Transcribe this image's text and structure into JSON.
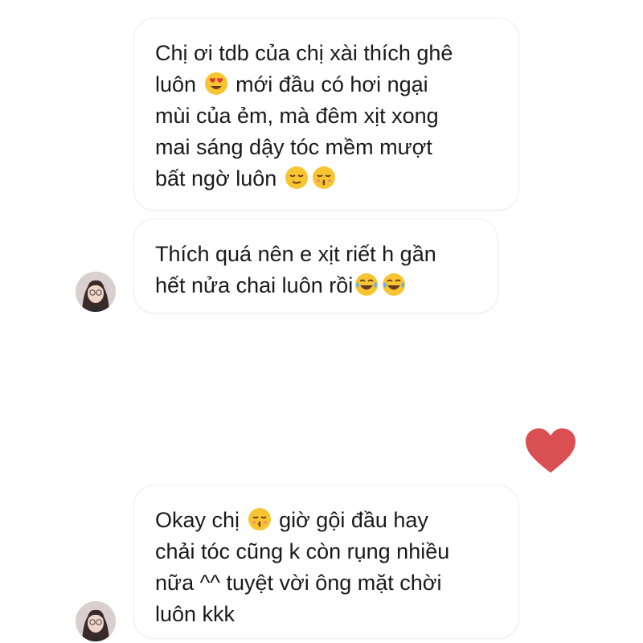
{
  "messages": [
    {
      "sender": "contact",
      "lines": [
        {
          "text": "Chị ơi tdb của chị xài thích ghê"
        },
        {
          "before": "luôn",
          "emoji": "heart-eyes-emoji",
          "after": "mới đầu có hơi ngại"
        },
        {
          "text": "mùi của ẻm, mà đêm xịt xong"
        },
        {
          "text": "mai sáng dậy tóc mềm mượt"
        },
        {
          "before": "bất ngờ luôn",
          "emojis": [
            "relieved-emoji",
            "kissing-emoji"
          ]
        }
      ]
    },
    {
      "sender": "contact",
      "lines": [
        {
          "text": "Thích quá nên e xịt riết h gần"
        },
        {
          "before": "hết nửa chai luôn rồi",
          "emojis": [
            "tears-of-joy-emoji",
            "tears-of-joy-emoji"
          ]
        }
      ]
    },
    {
      "sender": "contact",
      "lines": [
        {
          "before": "Okay chị",
          "emoji": "kissing-emoji",
          "after": "giờ gội đầu hay"
        },
        {
          "text": "chải tóc cũng k còn rụng nhiều"
        },
        {
          "text": "nữa ^^ tuyệt vời ông mặt chời"
        },
        {
          "text": "luôn kkk"
        }
      ]
    }
  ],
  "reaction": {
    "icon": "heart-icon",
    "color": "#d94f52"
  },
  "colors": {
    "bubble_border": "#ececec",
    "text": "#1a1a1a",
    "emoji_face": "#f7c531"
  }
}
